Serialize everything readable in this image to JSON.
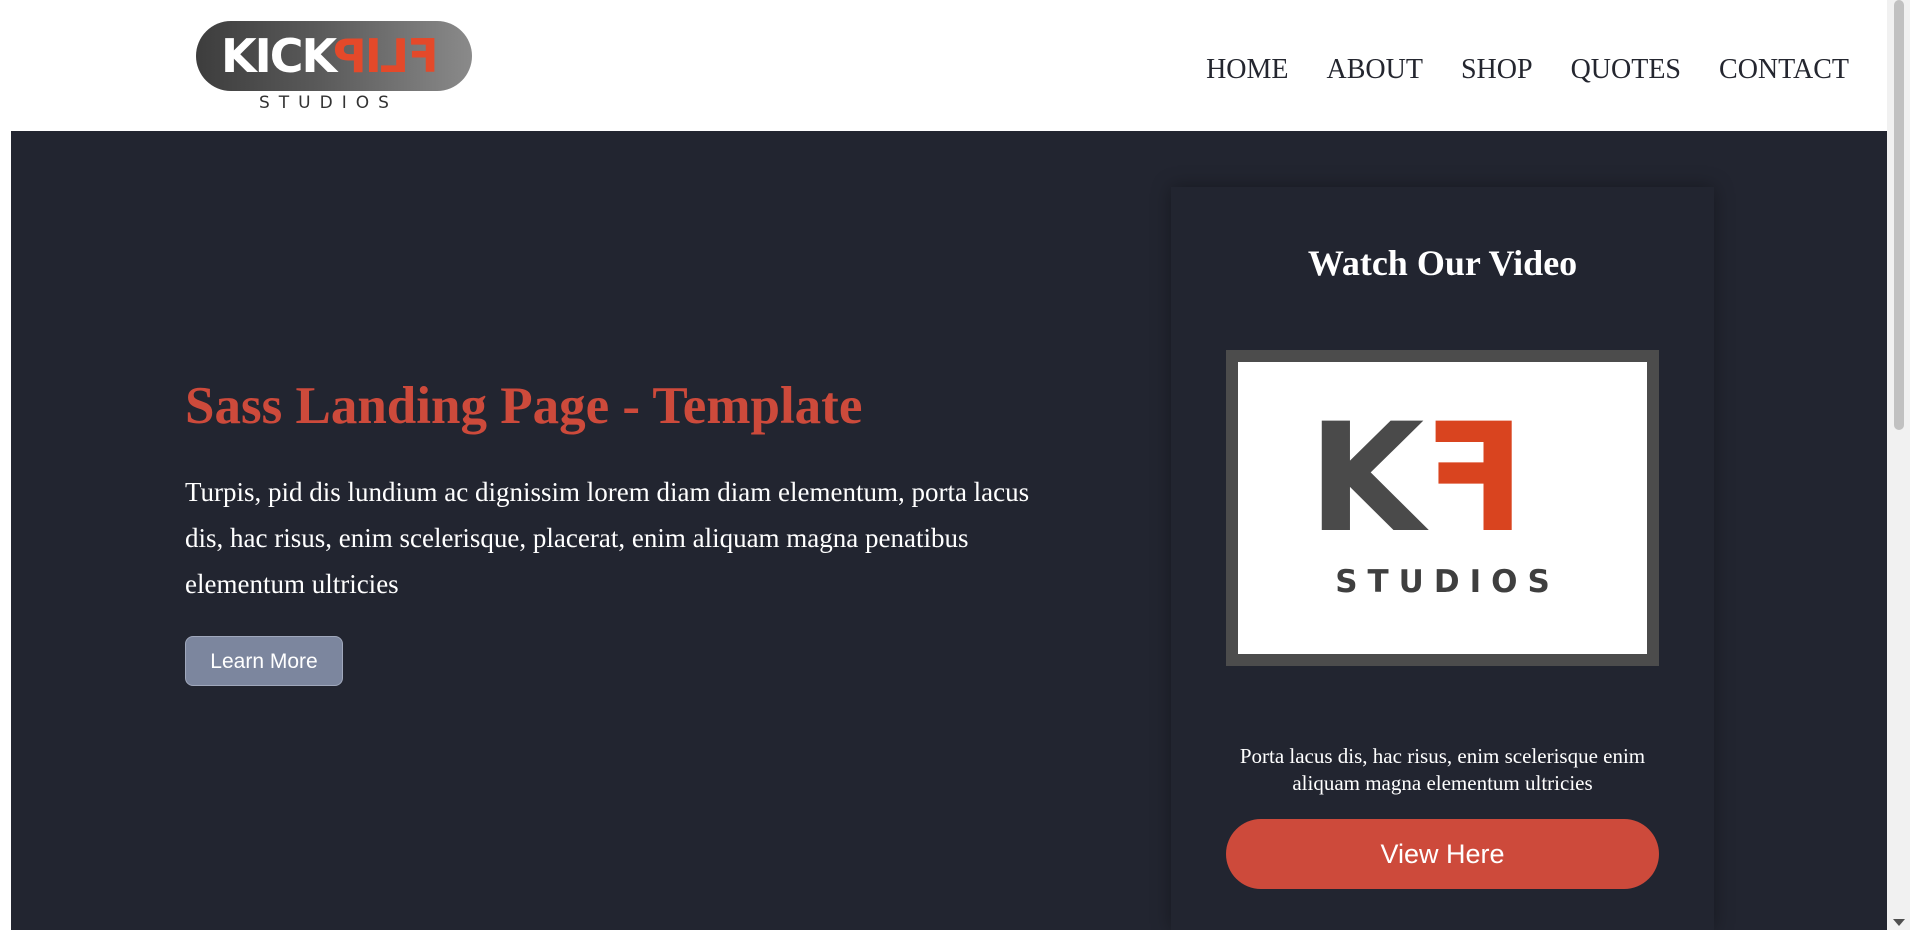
{
  "brand": {
    "logo_word_left": "KICK",
    "logo_word_right": "FLIP",
    "logo_sub": "STUDIOS",
    "colors": {
      "accent": "#cd4a3b",
      "logo_red": "#e4492a",
      "dark_bg": "#222530",
      "button_gray": "#7c869e"
    }
  },
  "nav": {
    "items": [
      {
        "label": "HOME"
      },
      {
        "label": "ABOUT"
      },
      {
        "label": "SHOP"
      },
      {
        "label": "QUOTES"
      },
      {
        "label": "CONTACT"
      }
    ]
  },
  "hero": {
    "title": "Sass Landing Page - Template",
    "text": "Turpis, pid dis lundium ac dignissim lorem diam diam elementum, porta lacus dis, hac risus, enim scelerisque, placerat, enim aliquam magna penatibus elementum ultricies",
    "button_label": "Learn More"
  },
  "video_card": {
    "title": "Watch Our Video",
    "thumb_letter_k": "K",
    "thumb_letter_f": "F",
    "thumb_sub": "STUDIOS",
    "text": "Porta lacus dis, hac risus, enim scelerisque enim aliquam magna elementum ultricies",
    "button_label": "View Here"
  }
}
